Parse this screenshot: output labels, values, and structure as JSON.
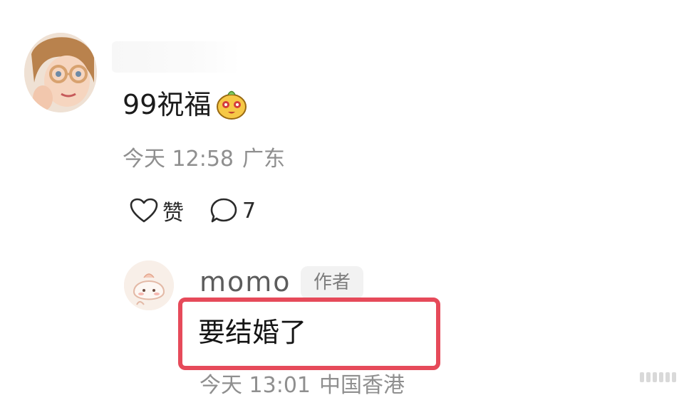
{
  "comment": {
    "text": "99祝福",
    "emoji": "smiling-face-emoji",
    "time": "今天 12:58",
    "location": "广东",
    "like_label": "赞",
    "reply_count": "7"
  },
  "reply": {
    "username": "momo",
    "badge": "作者",
    "text": "要结婚了",
    "time": "今天 13:01",
    "location": "中国香港"
  },
  "colors": {
    "highlight": "#e64a5a",
    "meta_text": "#8f8f8f",
    "badge_bg": "#f2f2f2"
  },
  "icons": {
    "like": "heart-icon",
    "reply": "comment-bubble-icon"
  }
}
